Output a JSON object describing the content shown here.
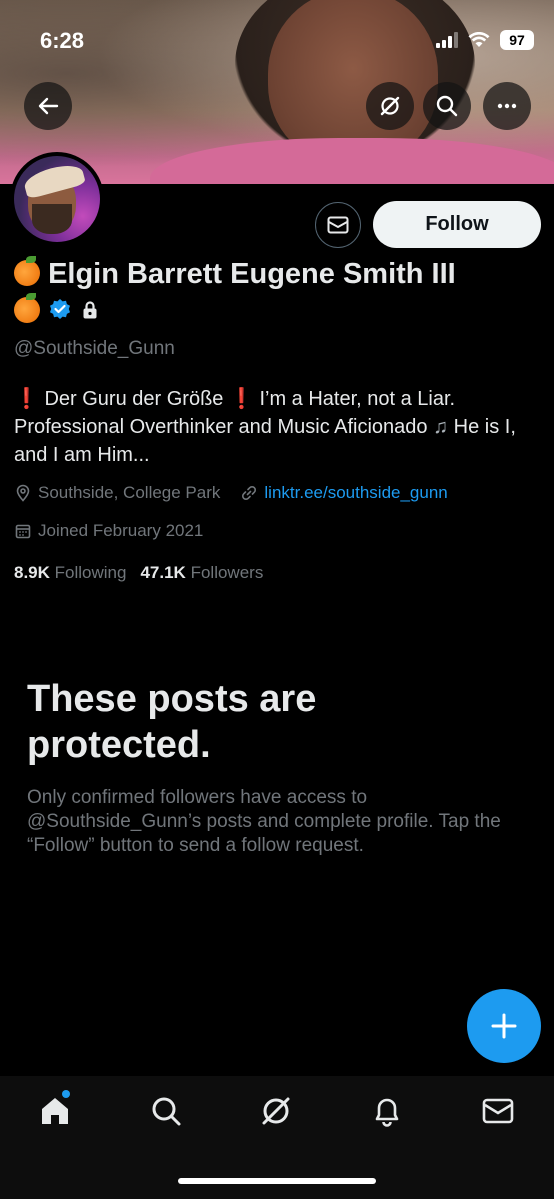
{
  "status_bar": {
    "time": "6:28",
    "battery": "97"
  },
  "profile": {
    "name_line1": "Elgin Barrett Eugene Smith III",
    "handle": "@Southside_Gunn",
    "follow_label": "Follow",
    "bio": {
      "line1_a": "Der Guru der Größe",
      "line1_b": "I’m a Hater, not a Liar.",
      "line2": "Professional Overthinker and Music Aficionado",
      "line2_b": "He is I, and I am Him..."
    },
    "location": "Southside, College Park",
    "website": "linktr.ee/southside_gunn",
    "joined": "Joined February 2021",
    "following_count": "8.9K",
    "following_label": "Following",
    "followers_count": "47.1K",
    "followers_label": "Followers"
  },
  "protected": {
    "title": "These posts are protected.",
    "body": "Only confirmed followers have access to @Southside_Gunn’s posts and complete profile. Tap the “Follow” button to send a follow request."
  },
  "colors": {
    "accent": "#1d9bf0",
    "background": "#000000",
    "muted": "#71767b"
  },
  "icons": [
    "back-arrow-icon",
    "grok-icon",
    "search-icon",
    "more-icon",
    "message-icon",
    "verified-icon",
    "lock-icon",
    "location-icon",
    "link-icon",
    "calendar-icon",
    "plus-icon",
    "home-icon",
    "bell-icon",
    "mail-icon"
  ]
}
